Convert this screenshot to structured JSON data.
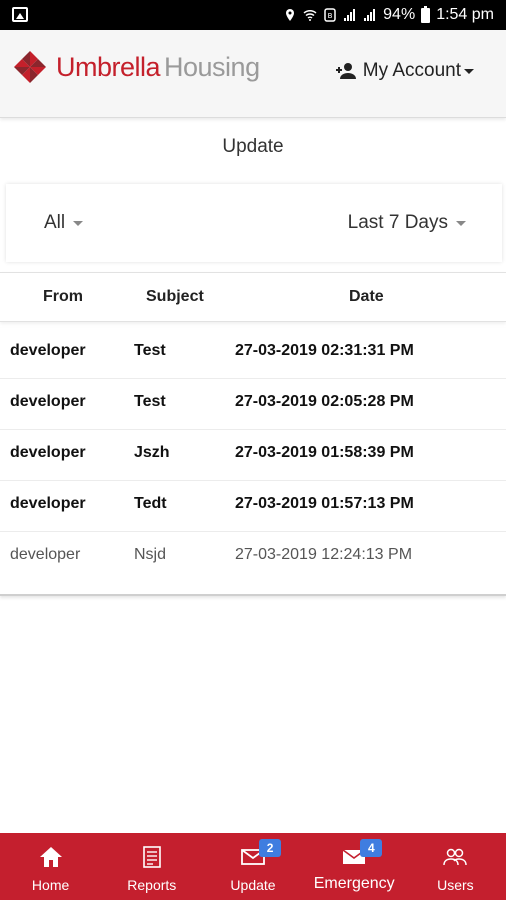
{
  "status_bar": {
    "battery": "94%",
    "time": "1:54 pm"
  },
  "header": {
    "brand_word1": "Umbrella",
    "brand_word2": "Housing",
    "account_label": "My Account"
  },
  "page": {
    "title": "Update"
  },
  "filters": {
    "type_value": "All",
    "range_value": "Last 7 Days"
  },
  "table": {
    "columns": [
      "From",
      "Subject",
      "Date"
    ],
    "rows": [
      {
        "from": "developer",
        "subject": "Test",
        "date": "27-03-2019 02:31:31 PM",
        "read": false
      },
      {
        "from": "developer",
        "subject": "Test",
        "date": "27-03-2019 02:05:28 PM",
        "read": false
      },
      {
        "from": "developer",
        "subject": "Jszh",
        "date": "27-03-2019 01:58:39 PM",
        "read": false
      },
      {
        "from": "developer",
        "subject": "Tedt",
        "date": "27-03-2019 01:57:13 PM",
        "read": false
      },
      {
        "from": "developer",
        "subject": "Nsjd",
        "date": "27-03-2019 12:24:13 PM",
        "read": true
      }
    ]
  },
  "bottom_nav": {
    "items": [
      {
        "label": "Home",
        "icon": "home-icon"
      },
      {
        "label": "Reports",
        "icon": "reports-icon"
      },
      {
        "label": "Update",
        "icon": "mail-icon",
        "badge": "2"
      },
      {
        "label": "Emergency",
        "icon": "mail-icon",
        "badge": "4"
      },
      {
        "label": "Users",
        "icon": "users-icon"
      }
    ],
    "background": "#c41f2e",
    "badge_color": "#3f7de0"
  },
  "colors": {
    "brand_red": "#c4202b",
    "brand_gray": "#9a9a9a"
  }
}
